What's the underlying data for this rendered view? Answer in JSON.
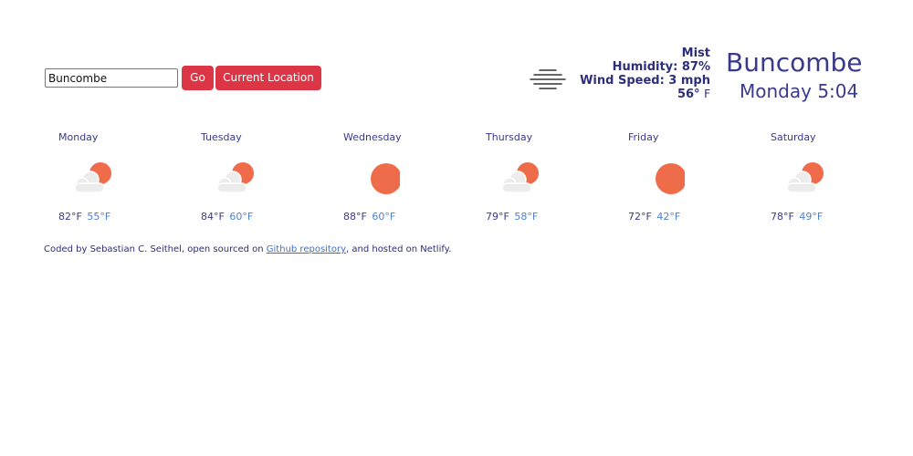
{
  "search": {
    "value": "Buncombe",
    "go_label": "Go",
    "location_label": "Current Location"
  },
  "current": {
    "icon": "mist-icon",
    "description": "Mist",
    "humidity": "Humidity: 87%",
    "wind": "Wind Speed: 3 mph",
    "temp": "56°",
    "temp_unit": "F",
    "city": "Buncombe",
    "datetime": "Monday 5:04"
  },
  "forecast": [
    {
      "day": "Monday",
      "icon": "partly-cloudy-icon",
      "high": "82°F",
      "low": "55°F"
    },
    {
      "day": "Tuesday",
      "icon": "partly-cloudy-icon",
      "high": "84°F",
      "low": "60°F"
    },
    {
      "day": "Wednesday",
      "icon": "sun-icon",
      "high": "88°F",
      "low": "60°F"
    },
    {
      "day": "Thursday",
      "icon": "partly-cloudy-icon",
      "high": "79°F",
      "low": "58°F"
    },
    {
      "day": "Friday",
      "icon": "sun-icon",
      "high": "72°F",
      "low": "42°F"
    },
    {
      "day": "Saturday",
      "icon": "partly-cloudy-icon",
      "high": "78°F",
      "low": "49°F"
    }
  ],
  "footer": {
    "prefix": "Coded by Sebastian C. Seithel, open sourced on ",
    "link_text": "Github repository",
    "suffix": ", and hosted on Netlify."
  },
  "colors": {
    "accent": "#dc3545",
    "text": "#3a3a8c",
    "low_temp": "#4a7fd8",
    "sun": "#ef6c4a",
    "cloud": "#ececec"
  }
}
